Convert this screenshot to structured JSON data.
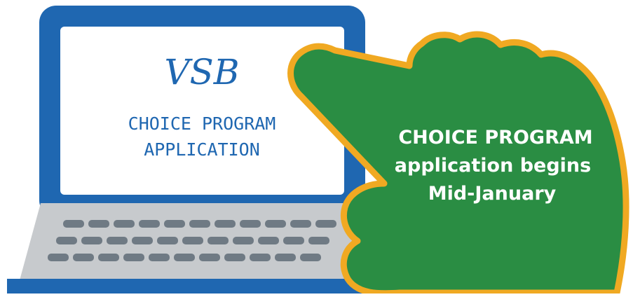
{
  "screen": {
    "logo_text": "VSB",
    "line1": "CHOICE PROGRAM",
    "line2": "APPLICATION"
  },
  "callout": {
    "line1": "CHOICE PROGRAM",
    "line2": "application begins",
    "line3": "Mid-January"
  },
  "colors": {
    "laptop_frame": "#1f67b1",
    "screen_bg": "#ffffff",
    "screen_text": "#1f67b1",
    "keyboard_body": "#c7cacd",
    "keys": "#6f7a84",
    "hand_fill": "#2a8d43",
    "hand_outline": "#f0a922",
    "callout_text": "#ffffff"
  }
}
